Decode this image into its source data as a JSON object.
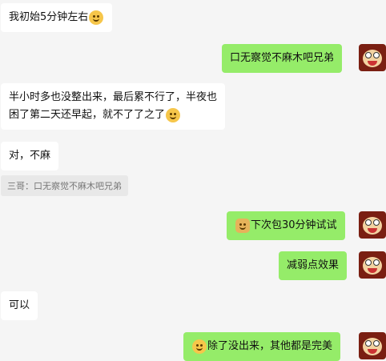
{
  "messages": {
    "m1": "我初始5分钟左右",
    "m2": "口无察觉不麻木吧兄弟",
    "m3_line1": "半小时多也没整出来，最后累不行了，半夜也",
    "m3_line2": "困了第二天还早起，就不了了之了",
    "m4": "对，不麻",
    "quote": "三哥：口无察觉不麻木吧兄弟",
    "m5": "下次包30分钟试试",
    "m6": "减弱点效果",
    "m7": "可以",
    "m8": "除了没出来，其他都是完美"
  },
  "icons": {
    "laugh": "laugh-cry-emoji-icon",
    "doge": "doge-emoji-icon",
    "avatar": "monkey-avatar"
  },
  "colors": {
    "background": "#f5f5f5",
    "incoming": "#ffffff",
    "outgoing": "#95ec69",
    "quote": "#e8e8e8"
  }
}
